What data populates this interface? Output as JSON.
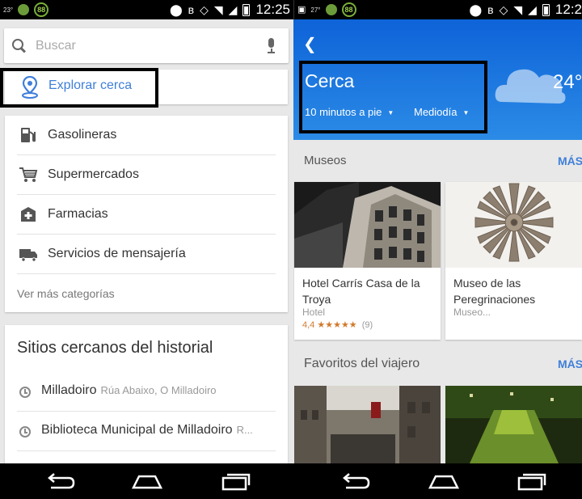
{
  "status_left": {
    "temp_small": "23°",
    "battery_percent": "88",
    "time": "12:25"
  },
  "status_right": {
    "temp_small": "27°",
    "battery_percent": "88",
    "time": "12:2"
  },
  "left": {
    "search": {
      "placeholder": "Buscar"
    },
    "explore_label": "Explorar cerca",
    "categories": [
      {
        "label": "Gasolineras",
        "icon": "gas-station-icon"
      },
      {
        "label": "Supermercados",
        "icon": "shopping-cart-icon"
      },
      {
        "label": "Farmacias",
        "icon": "pharmacy-icon"
      },
      {
        "label": "Servicios de mensajería",
        "icon": "truck-icon"
      }
    ],
    "more_categories": "Ver más categorías",
    "history_title": "Sitios cercanos del historial",
    "history": [
      {
        "name": "Milladoiro",
        "address": "Rúa Abaixo, O Milladoiro"
      },
      {
        "name": "Biblioteca Municipal de Milladoiro",
        "address": "R..."
      }
    ]
  },
  "right": {
    "title": "Cerca",
    "walk_filter": "10 minutos a pie",
    "time_filter": "Mediodía",
    "temperature": "24°",
    "museums_title": "Museos",
    "more_label": "MÁS",
    "places": [
      {
        "name": "Hotel Carrís Casa de la Troya",
        "type": "Hotel",
        "rating": "4,4",
        "stars": "★★★★★",
        "count": "(9)"
      },
      {
        "name": "Museo de las Peregrinaciones",
        "type": "Museo...",
        "rating": "",
        "stars": "",
        "count": ""
      }
    ],
    "favorites_title": "Favoritos del viajero",
    "favorites_more_label": "MÁS"
  },
  "colors": {
    "accent": "#3f7fd9",
    "header_blue": "#0e63d8",
    "star_orange": "#d27a2d"
  }
}
